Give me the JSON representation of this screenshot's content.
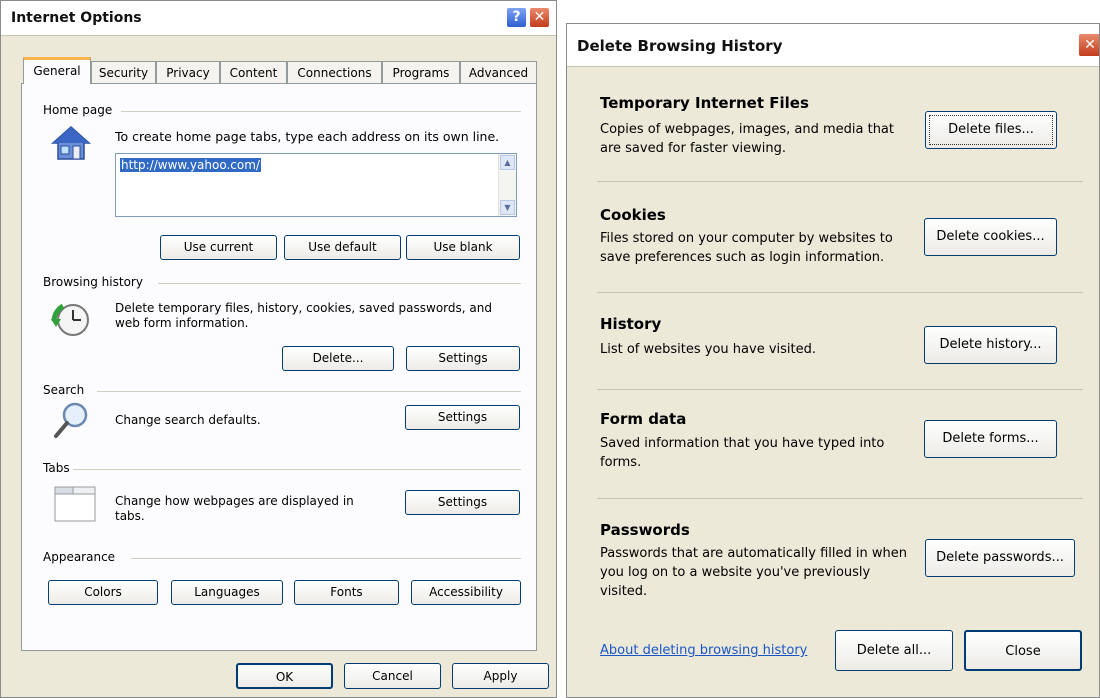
{
  "internet_options": {
    "title": "Internet Options",
    "help_glyph": "?",
    "close_glyph": "✕",
    "tabs": [
      "General",
      "Security",
      "Privacy",
      "Content",
      "Connections",
      "Programs",
      "Advanced"
    ],
    "home_page": {
      "heading": "Home page",
      "instruction": "To create home page tabs, type each address on its own line.",
      "value": "http://www.yahoo.com/",
      "buttons": [
        "Use current",
        "Use default",
        "Use blank"
      ]
    },
    "browsing_history": {
      "heading": "Browsing history",
      "description": "Delete temporary files, history, cookies, saved passwords, and web form information.",
      "buttons": [
        "Delete...",
        "Settings"
      ]
    },
    "search": {
      "heading": "Search",
      "description": "Change search defaults.",
      "button": "Settings"
    },
    "tabs_section": {
      "heading": "Tabs",
      "description": "Change how webpages are displayed in tabs.",
      "button": "Settings"
    },
    "appearance": {
      "heading": "Appearance",
      "buttons": [
        "Colors",
        "Languages",
        "Fonts",
        "Accessibility"
      ]
    },
    "footer_buttons": [
      "OK",
      "Cancel",
      "Apply"
    ]
  },
  "delete_history": {
    "title": "Delete Browsing History",
    "close_glyph": "✕",
    "sections": [
      {
        "heading": "Temporary Internet Files",
        "description": "Copies of webpages, images, and media that are saved for faster viewing.",
        "button": "Delete files..."
      },
      {
        "heading": "Cookies",
        "description": "Files stored on your computer by websites to save preferences such as login information.",
        "button": "Delete cookies..."
      },
      {
        "heading": "History",
        "description": "List of websites you have visited.",
        "button": "Delete history..."
      },
      {
        "heading": "Form data",
        "description": "Saved information that you have typed into forms.",
        "button": "Delete forms..."
      },
      {
        "heading": "Passwords",
        "description": "Passwords that are automatically filled in when you log on to a website you've previously visited.",
        "button": "Delete passwords..."
      }
    ],
    "about_link": "About deleting browsing history",
    "delete_all": "Delete all...",
    "close": "Close"
  },
  "icons": {
    "home": "house-icon",
    "history": "clock-icon",
    "search": "magnifier-icon",
    "tabs": "tabs-icon"
  },
  "colors": {
    "dialog_bg": "#ece9d8",
    "link": "#1a55c8",
    "active_tab_accent": "#f5b44c",
    "button_border": "#003c74"
  }
}
